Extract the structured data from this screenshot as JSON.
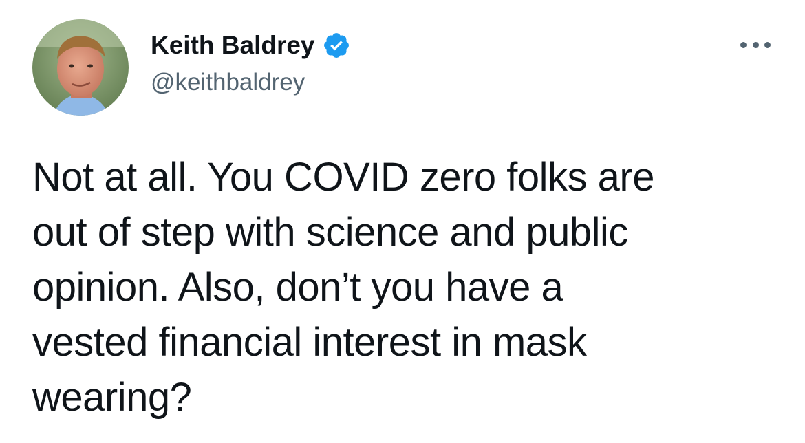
{
  "author": {
    "display_name": "Keith Baldrey",
    "handle": "@keithbaldrey",
    "verified": true,
    "avatar_icon": "user-avatar-photo",
    "verified_icon": "verified-badge-icon",
    "verified_color": "#1d9bf0"
  },
  "menu": {
    "icon": "more-horizontal-icon"
  },
  "tweet": {
    "text": "Not at all. You COVID zero folks are\nout of step with science and public\nopinion. Also, don’t you have a\nvested financial interest in mask\nwearing?"
  },
  "colors": {
    "text_primary": "#0f1419",
    "text_secondary": "#536471",
    "background": "#ffffff"
  }
}
